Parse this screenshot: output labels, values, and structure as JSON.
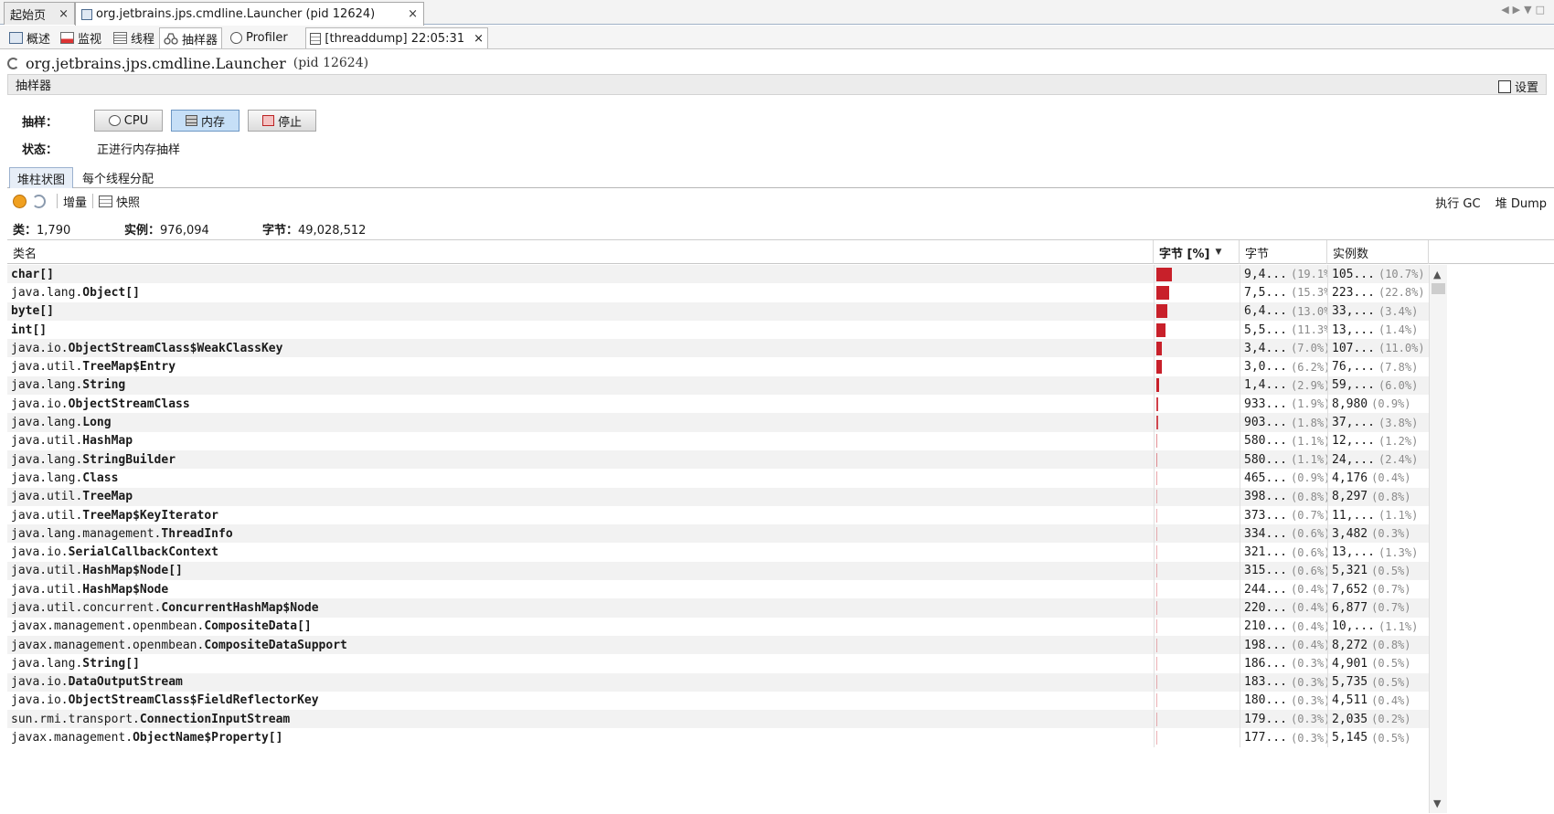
{
  "doc_tabs": [
    {
      "label": "起始页"
    },
    {
      "label": "org.jetbrains.jps.cmdline.Launcher (pid 12624)"
    }
  ],
  "close_glyph": "×",
  "sub_tabs": [
    {
      "label": "概述",
      "icon": "overview-icon"
    },
    {
      "label": "监视",
      "icon": "monitor-icon"
    },
    {
      "label": "线程",
      "icon": "threads-icon"
    },
    {
      "label": "抽样器",
      "icon": "sampler-icon"
    },
    {
      "label": "Profiler",
      "icon": "profiler-icon"
    },
    {
      "label": "[threaddump] 22:05:31",
      "icon": "threaddump-icon"
    }
  ],
  "app_title": "org.jetbrains.jps.cmdline.Launcher",
  "app_pid": "(pid 12624)",
  "section_title": "抽样器",
  "settings_label": "设置",
  "sample_label": "抽样：",
  "status_label": "状态：",
  "buttons": {
    "cpu": "CPU",
    "memory": "内存",
    "stop": "停止"
  },
  "status_value": "正进行内存抽样",
  "view_tabs": [
    "堆柱状图",
    "每个线程分配"
  ],
  "toolbar": {
    "delta": "增量",
    "snapshot": "快照",
    "gc": "执行 GC",
    "heap_dump": "堆 Dump"
  },
  "stats": {
    "classes_label": "类：",
    "classes_value": "1,790",
    "instances_label": "实例：",
    "instances_value": "976,094",
    "bytes_label": "字节：",
    "bytes_value": "49,028,512"
  },
  "columns": {
    "name": "类名",
    "bytes_pct": "字节 [%]",
    "bytes": "字节",
    "instances": "实例数"
  },
  "rows": [
    {
      "pkg": "",
      "cls": "char[]",
      "bytes": "9,4...",
      "bytes_pct": "(19.1%)",
      "inst": "105...",
      "inst_pct": "(10.7%)",
      "share": 19.1
    },
    {
      "pkg": "java.lang.",
      "cls": "Object[]",
      "bytes": "7,5...",
      "bytes_pct": "(15.3%)",
      "inst": "223...",
      "inst_pct": "(22.8%)",
      "share": 15.3
    },
    {
      "pkg": "",
      "cls": "byte[]",
      "bytes": "6,4...",
      "bytes_pct": "(13.0%)",
      "inst": "33,...",
      "inst_pct": "(3.4%)",
      "share": 13.0
    },
    {
      "pkg": "",
      "cls": "int[]",
      "bytes": "5,5...",
      "bytes_pct": "(11.3%)",
      "inst": "13,...",
      "inst_pct": "(1.4%)",
      "share": 11.3
    },
    {
      "pkg": "java.io.",
      "cls": "ObjectStreamClass$WeakClassKey",
      "bytes": "3,4...",
      "bytes_pct": "(7.0%)",
      "inst": "107...",
      "inst_pct": "(11.0%)",
      "share": 7.0
    },
    {
      "pkg": "java.util.",
      "cls": "TreeMap$Entry",
      "bytes": "3,0...",
      "bytes_pct": "(6.2%)",
      "inst": "76,...",
      "inst_pct": "(7.8%)",
      "share": 6.2
    },
    {
      "pkg": "java.lang.",
      "cls": "String",
      "bytes": "1,4...",
      "bytes_pct": "(2.9%)",
      "inst": "59,...",
      "inst_pct": "(6.0%)",
      "share": 2.9
    },
    {
      "pkg": "java.io.",
      "cls": "ObjectStreamClass",
      "bytes": "933...",
      "bytes_pct": "(1.9%)",
      "inst": "8,980",
      "inst_pct": "(0.9%)",
      "share": 1.9
    },
    {
      "pkg": "java.lang.",
      "cls": "Long",
      "bytes": "903...",
      "bytes_pct": "(1.8%)",
      "inst": "37,...",
      "inst_pct": "(3.8%)",
      "share": 1.8
    },
    {
      "pkg": "java.util.",
      "cls": "HashMap",
      "bytes": "580...",
      "bytes_pct": "(1.1%)",
      "inst": "12,...",
      "inst_pct": "(1.2%)",
      "share": 1.1
    },
    {
      "pkg": "java.lang.",
      "cls": "StringBuilder",
      "bytes": "580...",
      "bytes_pct": "(1.1%)",
      "inst": "24,...",
      "inst_pct": "(2.4%)",
      "share": 1.1
    },
    {
      "pkg": "java.lang.",
      "cls": "Class",
      "bytes": "465...",
      "bytes_pct": "(0.9%)",
      "inst": "4,176",
      "inst_pct": "(0.4%)",
      "share": 0.9
    },
    {
      "pkg": "java.util.",
      "cls": "TreeMap",
      "bytes": "398...",
      "bytes_pct": "(0.8%)",
      "inst": "8,297",
      "inst_pct": "(0.8%)",
      "share": 0.8
    },
    {
      "pkg": "java.util.",
      "cls": "TreeMap$KeyIterator",
      "bytes": "373...",
      "bytes_pct": "(0.7%)",
      "inst": "11,...",
      "inst_pct": "(1.1%)",
      "share": 0.7
    },
    {
      "pkg": "java.lang.management.",
      "cls": "ThreadInfo",
      "bytes": "334...",
      "bytes_pct": "(0.6%)",
      "inst": "3,482",
      "inst_pct": "(0.3%)",
      "share": 0.6
    },
    {
      "pkg": "java.io.",
      "cls": "SerialCallbackContext",
      "bytes": "321...",
      "bytes_pct": "(0.6%)",
      "inst": "13,...",
      "inst_pct": "(1.3%)",
      "share": 0.6
    },
    {
      "pkg": "java.util.",
      "cls": "HashMap$Node[]",
      "bytes": "315...",
      "bytes_pct": "(0.6%)",
      "inst": "5,321",
      "inst_pct": "(0.5%)",
      "share": 0.6
    },
    {
      "pkg": "java.util.",
      "cls": "HashMap$Node",
      "bytes": "244...",
      "bytes_pct": "(0.4%)",
      "inst": "7,652",
      "inst_pct": "(0.7%)",
      "share": 0.4
    },
    {
      "pkg": "java.util.concurrent.",
      "cls": "ConcurrentHashMap$Node",
      "bytes": "220...",
      "bytes_pct": "(0.4%)",
      "inst": "6,877",
      "inst_pct": "(0.7%)",
      "share": 0.4
    },
    {
      "pkg": "javax.management.openmbean.",
      "cls": "CompositeData[]",
      "bytes": "210...",
      "bytes_pct": "(0.4%)",
      "inst": "10,...",
      "inst_pct": "(1.1%)",
      "share": 0.4
    },
    {
      "pkg": "javax.management.openmbean.",
      "cls": "CompositeDataSupport",
      "bytes": "198...",
      "bytes_pct": "(0.4%)",
      "inst": "8,272",
      "inst_pct": "(0.8%)",
      "share": 0.4
    },
    {
      "pkg": "java.lang.",
      "cls": "String[]",
      "bytes": "186...",
      "bytes_pct": "(0.3%)",
      "inst": "4,901",
      "inst_pct": "(0.5%)",
      "share": 0.3
    },
    {
      "pkg": "java.io.",
      "cls": "DataOutputStream",
      "bytes": "183...",
      "bytes_pct": "(0.3%)",
      "inst": "5,735",
      "inst_pct": "(0.5%)",
      "share": 0.3
    },
    {
      "pkg": "java.io.",
      "cls": "ObjectStreamClass$FieldReflectorKey",
      "bytes": "180...",
      "bytes_pct": "(0.3%)",
      "inst": "4,511",
      "inst_pct": "(0.4%)",
      "share": 0.3
    },
    {
      "pkg": "sun.rmi.transport.",
      "cls": "ConnectionInputStream",
      "bytes": "179...",
      "bytes_pct": "(0.3%)",
      "inst": "2,035",
      "inst_pct": "(0.2%)",
      "share": 0.3
    },
    {
      "pkg": "javax.management.",
      "cls": "ObjectName$Property[]",
      "bytes": "177...",
      "bytes_pct": "(0.3%)",
      "inst": "5,145",
      "inst_pct": "(0.5%)",
      "share": 0.3
    }
  ],
  "colors": {
    "bar": "#c8202a",
    "row_alt": "#f2f2f2",
    "pressed_button": "#c6dff7"
  }
}
